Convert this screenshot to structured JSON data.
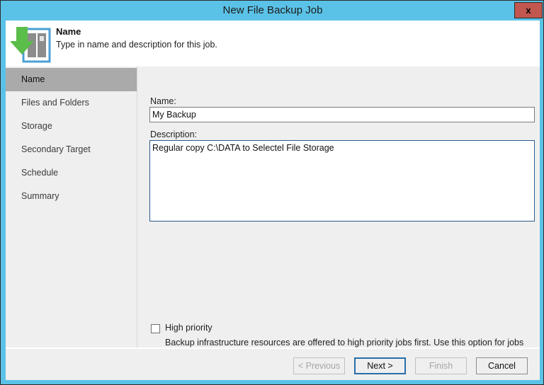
{
  "window": {
    "title": "New File Backup Job",
    "close_label": "x",
    "accent_color": "#5bc2e7",
    "close_color": "#c1574e"
  },
  "header": {
    "title": "Name",
    "subtitle": "Type in name and description for this job.",
    "icon": "backup-job-icon"
  },
  "sidebar": {
    "items": [
      {
        "label": "Name",
        "selected": true
      },
      {
        "label": "Files and Folders",
        "selected": false
      },
      {
        "label": "Storage",
        "selected": false
      },
      {
        "label": "Secondary Target",
        "selected": false
      },
      {
        "label": "Schedule",
        "selected": false
      },
      {
        "label": "Summary",
        "selected": false
      }
    ],
    "selected_color": "#aaaaaa"
  },
  "form": {
    "name_label": "Name:",
    "name_value": "My Backup",
    "name_placeholder": "",
    "description_label": "Description:",
    "description_value": "Regular copy C:\\DATA to Selectel File Storage",
    "description_placeholder": "",
    "high_priority_label": "High priority",
    "high_priority_checked": false,
    "high_priority_description": "Backup infrastructure resources are offered to high priority jobs first. Use this option for jobs sensitive to the start time, or jobs with strict RPO requirements."
  },
  "footer": {
    "previous_label": "< Previous",
    "previous_enabled": false,
    "next_label": "Next >",
    "next_enabled": true,
    "next_is_default": true,
    "finish_label": "Finish",
    "finish_enabled": false,
    "cancel_label": "Cancel",
    "cancel_enabled": true
  }
}
